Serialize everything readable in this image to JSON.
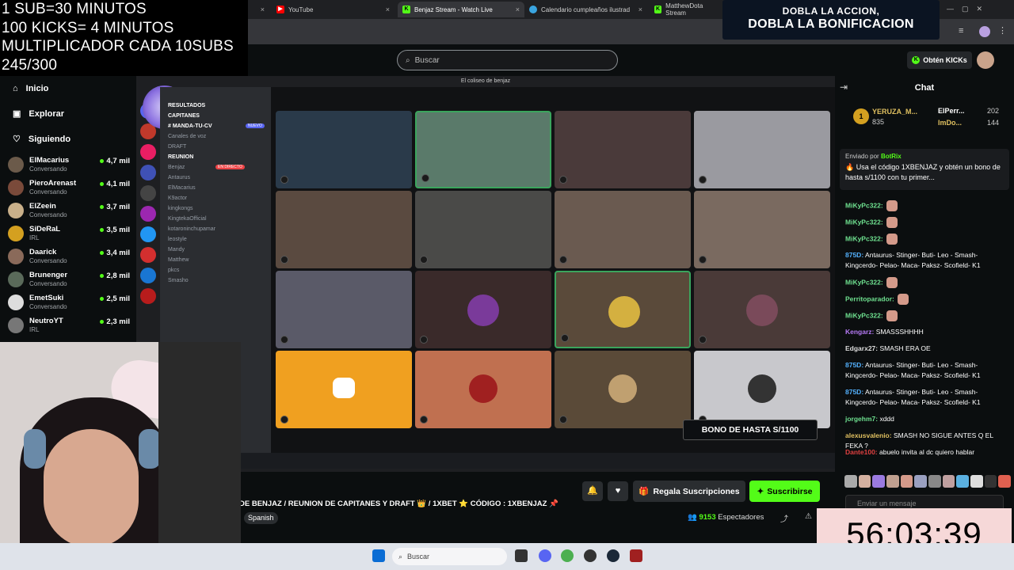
{
  "overlay": {
    "lines": [
      "1 SUB=30 MINUTOS",
      "100 KICKS= 4 MINUTOS",
      "MULTIPLICADOR CADA 10SUBS",
      "245/300"
    ],
    "banner_line1": "DOBLA LA ACCION,",
    "banner_line2": "DOBLA LA BONIFICACION",
    "bono_tag": "BONO DE HASTA S/1100",
    "timer": "56:03:39"
  },
  "browser": {
    "tabs": [
      {
        "label": "YouTube",
        "active": false
      },
      {
        "label": "Benjaz Stream - Watch Live",
        "active": true
      },
      {
        "label": "Calendario cumpleaños ilustrad",
        "active": false
      },
      {
        "label": "MatthewDota Stream",
        "active": false
      }
    ]
  },
  "header": {
    "search_placeholder": "Buscar",
    "kicks_button": "Obtén KICKs"
  },
  "sidebar": {
    "nav": [
      {
        "label": "Inicio",
        "icon": "home-icon"
      },
      {
        "label": "Explorar",
        "icon": "compass-icon"
      },
      {
        "label": "Siguiendo",
        "icon": "heart-icon"
      }
    ],
    "channels": [
      {
        "name": "ElMacarius",
        "category": "Conversando",
        "viewers": "4,7 mil",
        "color": "#6b5a4a"
      },
      {
        "name": "PieroArenast",
        "category": "Conversando",
        "viewers": "4,1 mil",
        "color": "#7a4a3a"
      },
      {
        "name": "ElZeein",
        "category": "Conversando",
        "viewers": "3,7 mil",
        "color": "#c9b08a"
      },
      {
        "name": "SiDeRaL",
        "category": "IRL",
        "viewers": "3,5 mil",
        "color": "#d4a020"
      },
      {
        "name": "Daarick",
        "category": "Conversando",
        "viewers": "3,4 mil",
        "color": "#8a6a5a"
      },
      {
        "name": "Brunenger",
        "category": "Conversando",
        "viewers": "2,8 mil",
        "color": "#5a6a5a"
      },
      {
        "name": "EmetSuki",
        "category": "Conversando",
        "viewers": "2,5 mil",
        "color": "#dddddd"
      },
      {
        "name": "NeutroYT",
        "category": "IRL",
        "viewers": "2,3 mil",
        "color": "#777777"
      }
    ]
  },
  "discord": {
    "window_title": "El coliseo de benjaz",
    "channels": [
      "RESULTADOS",
      "CAPITANES",
      "# MANDA-TU-CV",
      "Canales de voz",
      "DRAFT",
      "REUNION",
      "Benjaz",
      "Antaurus",
      "ElMacarius",
      "K9actor",
      "kingkongs",
      "KingtekaOfficial",
      "kotaroninchupamar",
      "leostyle",
      "Mandy",
      "Matthew",
      "pkcs",
      "Smasho"
    ],
    "live_badge": "EN DIRECTO",
    "new_badge": "NUEVO"
  },
  "stream": {
    "title": "DE BENJAZ / REUNION DE CAPITANES Y DRAFT 👑 / 1XBET ⭐ CÓDIGO : 1XBENJAZ 📌",
    "language": "Spanish",
    "viewers_count": "9153",
    "viewers_label": "Espectadores",
    "gift_button": "Regala Suscripciones",
    "subscribe_button": "Suscribirse"
  },
  "chat": {
    "title": "Chat",
    "leaderboard": [
      {
        "rank": "1",
        "name": "YERUZA_M...",
        "value": "835"
      },
      {
        "rank": "",
        "name": "ElPerr...",
        "value": "202"
      },
      {
        "rank": "",
        "name": "ImDo...",
        "value": "144"
      }
    ],
    "pinned_by_label": "Enviado por",
    "pinned_by": "BotRix",
    "pinned_text": "🔥 Usa el código 1XBENJAZ y obtén un bono de hasta s/1100 con tu primer...",
    "messages": [
      {
        "user": "MiKyPc322:",
        "text": "",
        "color": "#6ee08f"
      },
      {
        "user": "MiKyPc322:",
        "text": "",
        "color": "#6ee08f"
      },
      {
        "user": "MiKyPc322:",
        "text": "",
        "color": "#6ee08f"
      },
      {
        "user": "875D:",
        "text": "Antaurus- Stinger- Buti- Leo - Smash- Kingcerdo- Pelao- Maca- Paksz- Scofield- K1",
        "color": "#53b0fc"
      },
      {
        "user": "MiKyPc322:",
        "text": "",
        "color": "#6ee08f"
      },
      {
        "user": "Perritoparador:",
        "text": "",
        "color": "#6ee08f"
      },
      {
        "user": "MiKyPc322:",
        "text": "",
        "color": "#6ee08f"
      },
      {
        "user": "Kengarz:",
        "text": "SMASSSHHHH",
        "color": "#b57af5"
      },
      {
        "user": "Edgarx27:",
        "text": "SMASH ERA OE",
        "color": "#dddddd"
      },
      {
        "user": "875D:",
        "text": "Antaurus- Stinger- Buti- Leo - Smash- Kingcerdo- Pelao- Maca- Paksz- Scofield- K1",
        "color": "#53b0fc"
      },
      {
        "user": "875D:",
        "text": "Antaurus- Stinger- Buti- Leo - Smash- Kingcerdo- Pelao- Maca- Paksz- Scofield- K1",
        "color": "#53b0fc"
      },
      {
        "user": "jorgehm7:",
        "text": "xddd",
        "color": "#6ee08f"
      },
      {
        "user": "alexusvalenio:",
        "text": "SMASH NO SIGUE ANTES Q EL FEKA ?",
        "color": "#e0c060"
      },
      {
        "user": "Dante100:",
        "text": "abuelo invita al dc quiero hablar",
        "color": "#e04040"
      }
    ],
    "input_placeholder": "Enviar un mensaje"
  },
  "taskbar": {
    "search_placeholder": "Buscar"
  }
}
